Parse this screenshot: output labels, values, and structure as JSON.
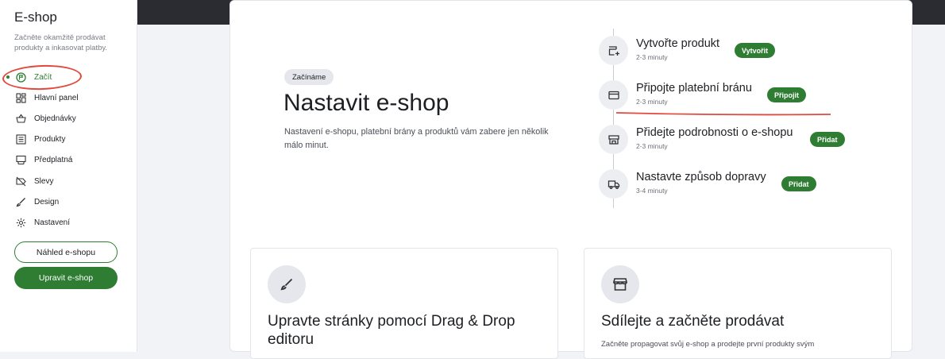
{
  "sidebar": {
    "title": "E-shop",
    "subtitle": "Začněte okamžitě prodávat produkty a inkasovat platby.",
    "items": [
      {
        "label": "Začít",
        "icon": "flag-icon"
      },
      {
        "label": "Hlavní panel",
        "icon": "dashboard-icon"
      },
      {
        "label": "Objednávky",
        "icon": "basket-icon"
      },
      {
        "label": "Produkty",
        "icon": "list-icon"
      },
      {
        "label": "Předplatná",
        "icon": "subscription-icon"
      },
      {
        "label": "Slevy",
        "icon": "discount-icon"
      },
      {
        "label": "Design",
        "icon": "brush-icon"
      },
      {
        "label": "Nastavení",
        "icon": "gear-icon"
      }
    ],
    "preview_button": "Náhled e-shopu",
    "edit_button": "Upravit e-shop"
  },
  "main": {
    "chip": "Začínáme",
    "title": "Nastavit e-shop",
    "description": "Nastavení e-shopu, platební brány a produktů vám zabere jen několik málo minut.",
    "steps": [
      {
        "title": "Vytvořte produkt",
        "duration": "2-3 minuty",
        "button": "Vytvořit",
        "icon": "product-add-icon"
      },
      {
        "title": "Připojte platební bránu",
        "duration": "2-3 minuty",
        "button": "Připojit",
        "icon": "card-icon"
      },
      {
        "title": "Přidejte podrobnosti o e-shopu",
        "duration": "2-3 minuty",
        "button": "Přidat",
        "icon": "store-icon"
      },
      {
        "title": "Nastavte způsob dopravy",
        "duration": "3-4 minuty",
        "button": "Přidat",
        "icon": "truck-icon"
      }
    ],
    "cards": [
      {
        "title": "Upravte stránky pomocí Drag & Drop editoru",
        "description": "",
        "icon": "brush-icon"
      },
      {
        "title": "Sdílejte a začněte prodávat",
        "description": "Začněte propagovat svůj e-shop a prodejte první produkty svým",
        "icon": "storefront-icon"
      }
    ]
  },
  "colors": {
    "accent": "#2e7d32",
    "annotation": "#e2493c",
    "topbar": "#2b2c31"
  }
}
